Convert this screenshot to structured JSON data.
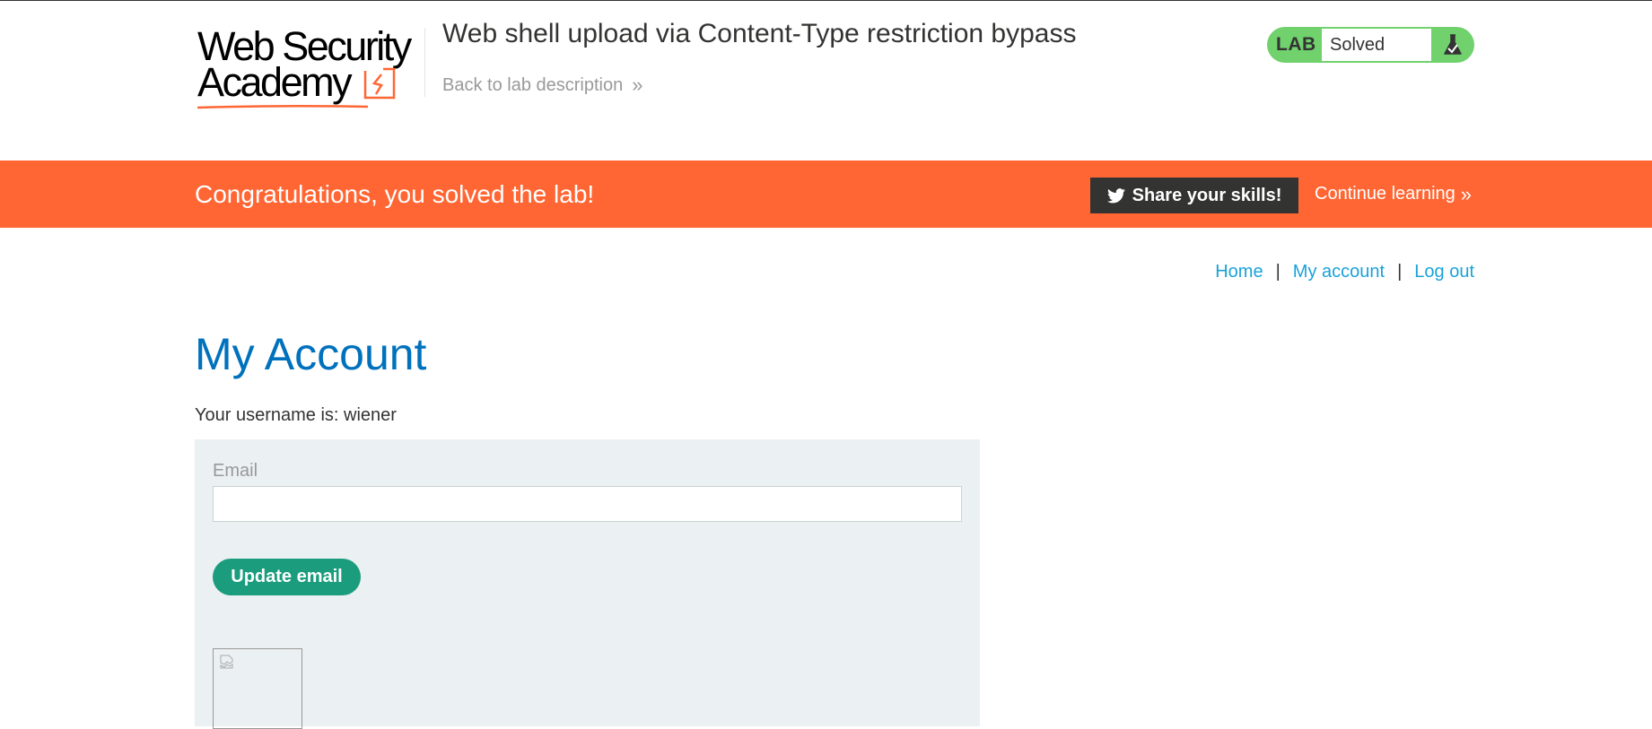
{
  "header": {
    "logo_line1": "Web Security",
    "logo_line2": "Academy",
    "lab_title": "Web shell upload via Content-Type restriction bypass",
    "back_link": "Back to lab description",
    "back_chevrons": "»"
  },
  "lab_status": {
    "label": "LAB",
    "value": "Solved",
    "icon": "flask-icon"
  },
  "banner": {
    "message": "Congratulations, you solved the lab!",
    "share_label": "Share your skills!",
    "continue_label": "Continue learning",
    "continue_chevrons": "»",
    "color": "#ff6633"
  },
  "nav": {
    "home": "Home",
    "separator": "|",
    "my_account": "My account",
    "log_out": "Log out"
  },
  "main": {
    "title": "My Account",
    "username_line": "Your username is: wiener",
    "email_label": "Email",
    "email_value": "",
    "update_button": "Update email"
  },
  "colors": {
    "accent_blue": "#0071bc",
    "link_blue": "#1aa2d8",
    "solved_green": "#70d16d",
    "button_green": "#1a9c7d"
  }
}
